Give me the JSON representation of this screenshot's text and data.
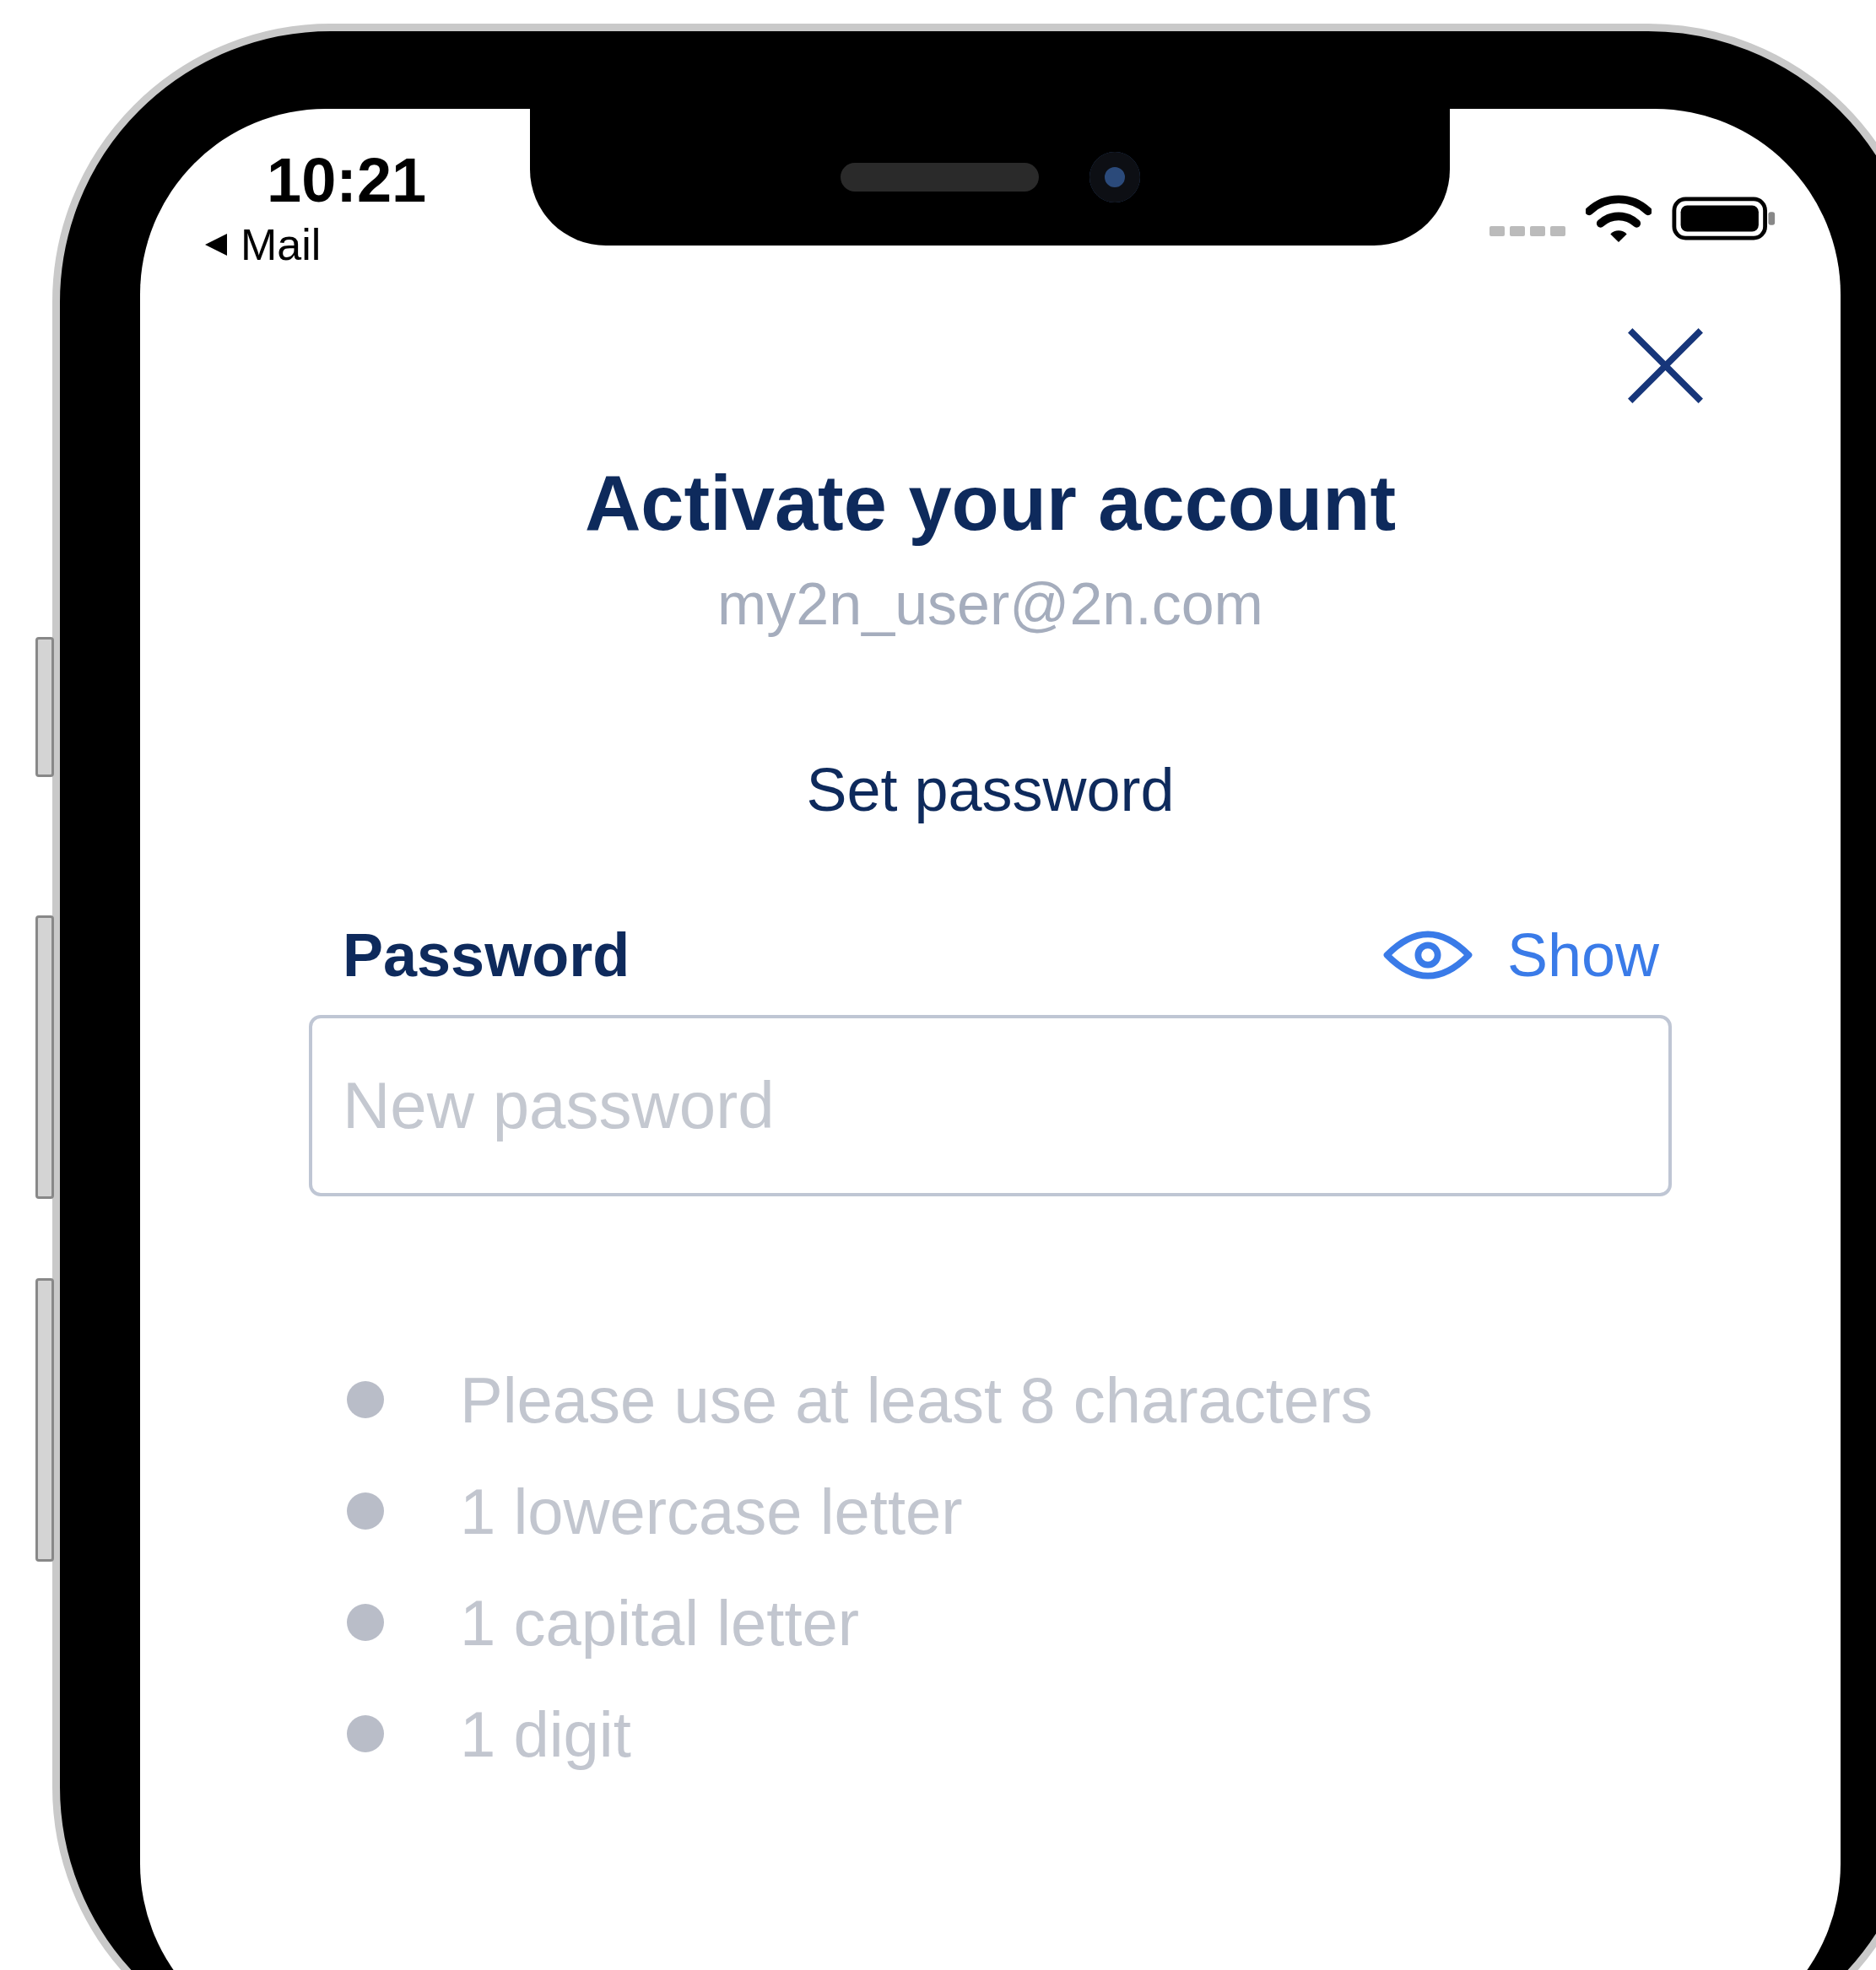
{
  "status_bar": {
    "time": "10:21",
    "back_label": "Mail"
  },
  "title": "Activate your account",
  "email": "my2n_user@2n.com",
  "subtitle": "Set password",
  "password": {
    "label": "Password",
    "toggle_label": "Show",
    "placeholder": "New password"
  },
  "requirements": [
    {
      "text": "Please use at least 8 characters",
      "met": false
    },
    {
      "text": "1 lowercase letter",
      "met": false
    },
    {
      "text": "1 capital letter",
      "met": false
    },
    {
      "text": "1 digit",
      "met": false
    }
  ]
}
